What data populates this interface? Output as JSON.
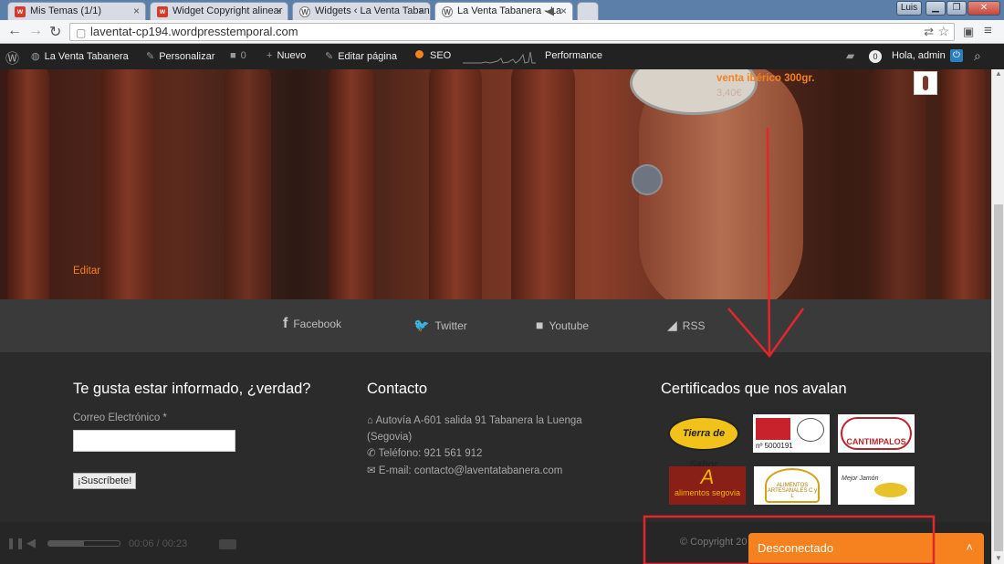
{
  "browser": {
    "tabs": [
      {
        "title": "Mis Temas (1/1)",
        "favicon": "wu"
      },
      {
        "title": "Widget Copyright alinear",
        "favicon": "wu"
      },
      {
        "title": "Widgets ‹ La Venta Tabanera",
        "favicon": "wp"
      },
      {
        "title": "La Venta Tabanera - La",
        "favicon": "wp"
      }
    ],
    "user_badge": "Luis",
    "url": "laventat-cp194.wordpresstemporal.com"
  },
  "adminbar": {
    "site_name": "La Venta Tabanera",
    "customize": "Personalizar",
    "comments_count": "0",
    "new": "Nuevo",
    "edit_page": "Editar página",
    "seo": "SEO",
    "performance": "Performance",
    "notifications": "0",
    "greeting": "Hola, admin"
  },
  "hero": {
    "product_name": "venta ibérico 300gr.",
    "product_price": "3,40€",
    "edit_link": "Editar"
  },
  "social": {
    "items": [
      {
        "label": "Facebook",
        "icon": "facebook-icon"
      },
      {
        "label": "Twitter",
        "icon": "twitter-icon"
      },
      {
        "label": "Youtube",
        "icon": "youtube-icon"
      },
      {
        "label": "RSS",
        "icon": "rss-icon"
      }
    ]
  },
  "newsletter": {
    "heading": "Te gusta estar informado, ¿verdad?",
    "email_label": "Correo Electrónico *",
    "email_value": "",
    "subscribe": "¡Suscríbete!"
  },
  "contact": {
    "heading": "Contacto",
    "address_line1": "Autovía A-601 salida 91 Tabanera la Luenga",
    "address_line2": "(Segovia)",
    "phone": "Teléfono: 921 561 912",
    "email": "E-mail: contacto@laventatabanera.com"
  },
  "certificates": {
    "heading": "Certificados que nos avalan",
    "logos": [
      {
        "text": "Tierra de Sabor"
      },
      {
        "text": "nº 5000191"
      },
      {
        "text": "CANTIMPALOS"
      },
      {
        "text": "alimentos segovia"
      },
      {
        "text": "ALIMENTOS ARTESANALES C y L"
      },
      {
        "text": "Mejor Jamón"
      }
    ]
  },
  "player": {
    "time": "00:06 / 00:23"
  },
  "copyright": "© Copyright 20",
  "chat": {
    "status": "Desconectado"
  },
  "colors": {
    "accent_orange": "#f5821f",
    "annotation_red": "#e3262b"
  }
}
